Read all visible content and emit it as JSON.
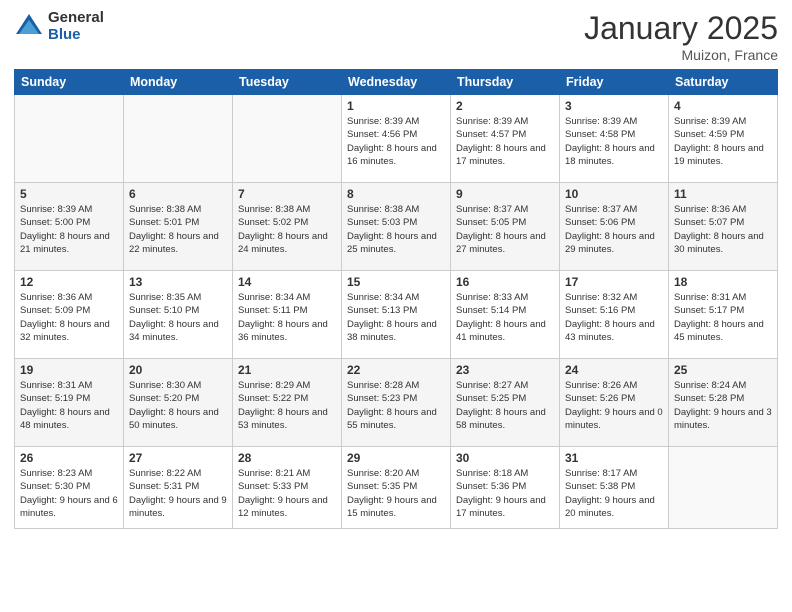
{
  "logo": {
    "general": "General",
    "blue": "Blue"
  },
  "header": {
    "month_year": "January 2025",
    "location": "Muizon, France"
  },
  "weekdays": [
    "Sunday",
    "Monday",
    "Tuesday",
    "Wednesday",
    "Thursday",
    "Friday",
    "Saturday"
  ],
  "weeks": [
    [
      {
        "day": "",
        "info": ""
      },
      {
        "day": "",
        "info": ""
      },
      {
        "day": "",
        "info": ""
      },
      {
        "day": "1",
        "info": "Sunrise: 8:39 AM\nSunset: 4:56 PM\nDaylight: 8 hours\nand 16 minutes."
      },
      {
        "day": "2",
        "info": "Sunrise: 8:39 AM\nSunset: 4:57 PM\nDaylight: 8 hours\nand 17 minutes."
      },
      {
        "day": "3",
        "info": "Sunrise: 8:39 AM\nSunset: 4:58 PM\nDaylight: 8 hours\nand 18 minutes."
      },
      {
        "day": "4",
        "info": "Sunrise: 8:39 AM\nSunset: 4:59 PM\nDaylight: 8 hours\nand 19 minutes."
      }
    ],
    [
      {
        "day": "5",
        "info": "Sunrise: 8:39 AM\nSunset: 5:00 PM\nDaylight: 8 hours\nand 21 minutes."
      },
      {
        "day": "6",
        "info": "Sunrise: 8:38 AM\nSunset: 5:01 PM\nDaylight: 8 hours\nand 22 minutes."
      },
      {
        "day": "7",
        "info": "Sunrise: 8:38 AM\nSunset: 5:02 PM\nDaylight: 8 hours\nand 24 minutes."
      },
      {
        "day": "8",
        "info": "Sunrise: 8:38 AM\nSunset: 5:03 PM\nDaylight: 8 hours\nand 25 minutes."
      },
      {
        "day": "9",
        "info": "Sunrise: 8:37 AM\nSunset: 5:05 PM\nDaylight: 8 hours\nand 27 minutes."
      },
      {
        "day": "10",
        "info": "Sunrise: 8:37 AM\nSunset: 5:06 PM\nDaylight: 8 hours\nand 29 minutes."
      },
      {
        "day": "11",
        "info": "Sunrise: 8:36 AM\nSunset: 5:07 PM\nDaylight: 8 hours\nand 30 minutes."
      }
    ],
    [
      {
        "day": "12",
        "info": "Sunrise: 8:36 AM\nSunset: 5:09 PM\nDaylight: 8 hours\nand 32 minutes."
      },
      {
        "day": "13",
        "info": "Sunrise: 8:35 AM\nSunset: 5:10 PM\nDaylight: 8 hours\nand 34 minutes."
      },
      {
        "day": "14",
        "info": "Sunrise: 8:34 AM\nSunset: 5:11 PM\nDaylight: 8 hours\nand 36 minutes."
      },
      {
        "day": "15",
        "info": "Sunrise: 8:34 AM\nSunset: 5:13 PM\nDaylight: 8 hours\nand 38 minutes."
      },
      {
        "day": "16",
        "info": "Sunrise: 8:33 AM\nSunset: 5:14 PM\nDaylight: 8 hours\nand 41 minutes."
      },
      {
        "day": "17",
        "info": "Sunrise: 8:32 AM\nSunset: 5:16 PM\nDaylight: 8 hours\nand 43 minutes."
      },
      {
        "day": "18",
        "info": "Sunrise: 8:31 AM\nSunset: 5:17 PM\nDaylight: 8 hours\nand 45 minutes."
      }
    ],
    [
      {
        "day": "19",
        "info": "Sunrise: 8:31 AM\nSunset: 5:19 PM\nDaylight: 8 hours\nand 48 minutes."
      },
      {
        "day": "20",
        "info": "Sunrise: 8:30 AM\nSunset: 5:20 PM\nDaylight: 8 hours\nand 50 minutes."
      },
      {
        "day": "21",
        "info": "Sunrise: 8:29 AM\nSunset: 5:22 PM\nDaylight: 8 hours\nand 53 minutes."
      },
      {
        "day": "22",
        "info": "Sunrise: 8:28 AM\nSunset: 5:23 PM\nDaylight: 8 hours\nand 55 minutes."
      },
      {
        "day": "23",
        "info": "Sunrise: 8:27 AM\nSunset: 5:25 PM\nDaylight: 8 hours\nand 58 minutes."
      },
      {
        "day": "24",
        "info": "Sunrise: 8:26 AM\nSunset: 5:26 PM\nDaylight: 9 hours\nand 0 minutes."
      },
      {
        "day": "25",
        "info": "Sunrise: 8:24 AM\nSunset: 5:28 PM\nDaylight: 9 hours\nand 3 minutes."
      }
    ],
    [
      {
        "day": "26",
        "info": "Sunrise: 8:23 AM\nSunset: 5:30 PM\nDaylight: 9 hours\nand 6 minutes."
      },
      {
        "day": "27",
        "info": "Sunrise: 8:22 AM\nSunset: 5:31 PM\nDaylight: 9 hours\nand 9 minutes."
      },
      {
        "day": "28",
        "info": "Sunrise: 8:21 AM\nSunset: 5:33 PM\nDaylight: 9 hours\nand 12 minutes."
      },
      {
        "day": "29",
        "info": "Sunrise: 8:20 AM\nSunset: 5:35 PM\nDaylight: 9 hours\nand 15 minutes."
      },
      {
        "day": "30",
        "info": "Sunrise: 8:18 AM\nSunset: 5:36 PM\nDaylight: 9 hours\nand 17 minutes."
      },
      {
        "day": "31",
        "info": "Sunrise: 8:17 AM\nSunset: 5:38 PM\nDaylight: 9 hours\nand 20 minutes."
      },
      {
        "day": "",
        "info": ""
      }
    ]
  ]
}
